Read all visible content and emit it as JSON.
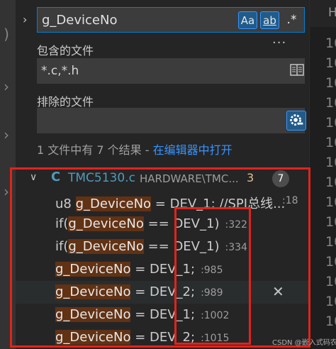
{
  "activity": {
    "icon1": "files-icon",
    "icon2": "scm-icon",
    "icon3": "debug-icon",
    "icon4": "extensions-icon"
  },
  "search": {
    "value": "g_DeviceNo",
    "match_case_label": "Aa",
    "whole_word_label": "ab",
    "regex_label": ".*"
  },
  "include": {
    "label": "包含的文件",
    "value": "*.c,*.h"
  },
  "exclude": {
    "label": "排除的文件",
    "value": ""
  },
  "summary": {
    "text": "1 文件中有 7 个结果 - ",
    "link": "在编辑器中打开"
  },
  "file": {
    "type_icon": "C",
    "name": "TMC5130.c",
    "path": "HARDWARE\\TMC...",
    "problems": "3",
    "match_count": "7"
  },
  "matches": [
    {
      "pre": "u8 ",
      "hit": "g_DeviceNo",
      "post": " = DEV_1; //SPI总线...",
      "line": ":18"
    },
    {
      "pre": "if(",
      "hit": "g_DeviceNo",
      "post": " == DEV_1)",
      "line": ":322"
    },
    {
      "pre": "if(",
      "hit": "g_DeviceNo",
      "post": " == DEV_1)",
      "line": ":334"
    },
    {
      "pre": "",
      "hit": "g_DeviceNo",
      "post": " = DEV_1;",
      "line": ":985"
    },
    {
      "pre": "",
      "hit": "g_DeviceNo",
      "post": " = DEV_2;",
      "line": ":989"
    },
    {
      "pre": "",
      "hit": "g_DeviceNo",
      "post": " = DEV_1;",
      "line": ":1002"
    },
    {
      "pre": "",
      "hit": "g_DeviceNo",
      "post": " = DEV_2;",
      "line": ":1015"
    }
  ],
  "editor": {
    "tab": "HA",
    "lines": [
      "10",
      "10",
      "10",
      "10",
      "10",
      "10",
      "10",
      "10",
      "10",
      "10",
      "10",
      "10",
      "10",
      "10",
      "10"
    ]
  },
  "watermark": "CSDN @嵌入式码农骐踪"
}
